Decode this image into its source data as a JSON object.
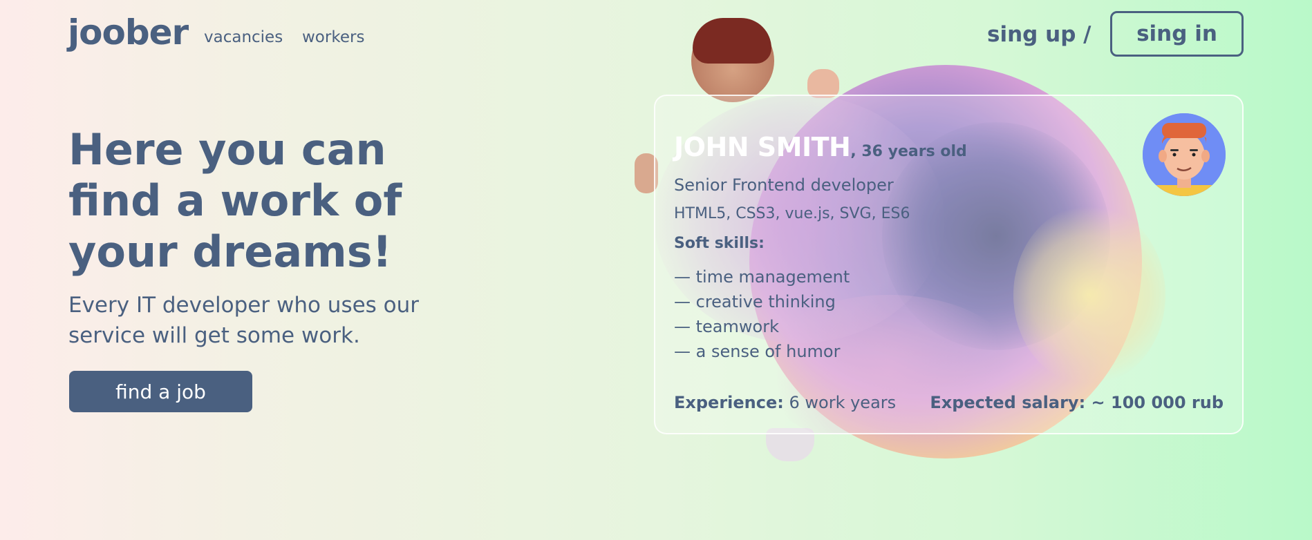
{
  "header": {
    "logo": "joober",
    "nav": [
      "vacancies",
      "workers"
    ],
    "signup_label": "sing up /",
    "signin_label": "sing in"
  },
  "hero": {
    "title": "Here you can find a work of your dreams!",
    "subtitle": "Every IT developer who uses our service will get some work.",
    "cta_label": "find a job"
  },
  "card": {
    "name": "JOHN SMITH",
    "age": ", 36 years old",
    "role": "Senior Frontend developer",
    "stack": "HTML5, CSS3, vue.js, SVG, ES6",
    "soft_skills_title": "Soft skills:",
    "soft_skills": [
      "— time management",
      "— creative thinking",
      "— teamwork",
      "— a sense of humor"
    ],
    "experience_label": "Experience:",
    "experience_value": " 6 work years",
    "salary_label": "Expected salary: ~ 100 000 rub"
  },
  "colors": {
    "primary": "#4a6080",
    "avatar_bg": "#6f8df5"
  }
}
